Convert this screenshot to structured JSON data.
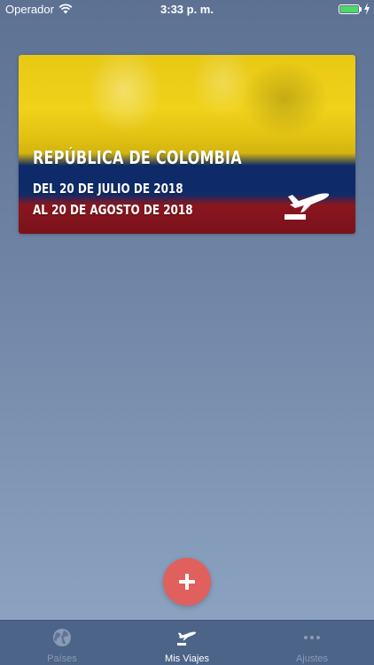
{
  "status_bar": {
    "carrier": "Operador",
    "time": "3:33 p. m.",
    "battery_color": "#4cd964"
  },
  "trip": {
    "country": "REPÚBLICA DE COLOMBIA",
    "date_from": "DEL 20 DE JULIO DE 2018",
    "date_to": "AL 20 DE AGOSTO DE 2018",
    "icon": "plane-departure-icon",
    "flag_colors": [
      "#f0d21a",
      "#102f73",
      "#9b1822"
    ]
  },
  "add_button": {
    "icon": "plus-icon",
    "color": "#e0605e"
  },
  "tabs": [
    {
      "label": "Países",
      "icon": "globe-icon",
      "active": false
    },
    {
      "label": "Mis Viajes",
      "icon": "plane-departure-icon",
      "active": true
    },
    {
      "label": "Ajustes",
      "icon": "more-icon",
      "active": false
    }
  ]
}
